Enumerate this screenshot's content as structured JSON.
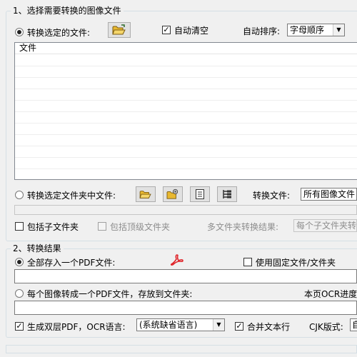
{
  "section1": {
    "title": "1、选择需要转换的图像文件",
    "radio_selected_files": "转换选定的文件:",
    "auto_clear": "自动清空",
    "auto_sort_label": "自动排序:",
    "auto_sort_value": "字母顺序",
    "list_header_file": "文件",
    "radio_folder_files": "转换选定文件夹中文件:",
    "convert_files_label": "转换文件:",
    "convert_files_value": "所有图像文件",
    "include_subfolders": "包括子文件夹",
    "include_top_folder": "包括顶级文件夹",
    "multi_folder_result_label": "多文件夹转换结果:",
    "multi_folder_result_value": "每个子文件夹转"
  },
  "section2": {
    "title": "2、转换结果",
    "radio_single_pdf": "全部存入一个PDF文件:",
    "use_fixed_file": "使用固定文件/文件夹",
    "radio_each_image": "每个图像转成一个PDF文件，存放到文件夹:",
    "ocr_progress_label": "本页OCR进度",
    "dual_layer_pdf": "生成双层PDF，OCR语言:",
    "ocr_language_value": "(系统缺省语言)",
    "merge_text_lines": "合并文本行",
    "cjk_layout_label": "CJK版式:",
    "cjk_layout_value": "自"
  },
  "colors": {
    "pdf_icon": "#e0262b",
    "folder_icon": "#e8b830"
  }
}
